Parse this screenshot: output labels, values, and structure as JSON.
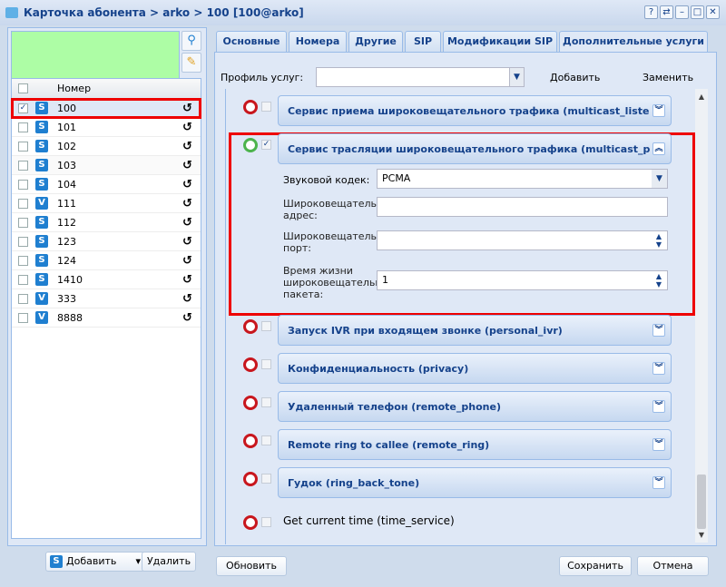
{
  "window": {
    "title": "Карточка абонента > arko > 100 [100@arko]",
    "controls": [
      "?",
      "⇄",
      "–",
      "□",
      "✕"
    ]
  },
  "left": {
    "header": "Номер",
    "rows": [
      {
        "num": "100",
        "type": "S",
        "checked": true
      },
      {
        "num": "101",
        "type": "S"
      },
      {
        "num": "102",
        "type": "S"
      },
      {
        "num": "103",
        "type": "S"
      },
      {
        "num": "104",
        "type": "S"
      },
      {
        "num": "111",
        "type": "V"
      },
      {
        "num": "112",
        "type": "S"
      },
      {
        "num": "123",
        "type": "S"
      },
      {
        "num": "124",
        "type": "S"
      },
      {
        "num": "1410",
        "type": "S"
      },
      {
        "num": "333",
        "type": "V"
      },
      {
        "num": "8888",
        "type": "V"
      }
    ],
    "add_label": "Добавить",
    "delete_label": "Удалить"
  },
  "tabs": [
    "Основные",
    "Номера",
    "Другие",
    "SIP",
    "Модификации SIP",
    "Дополнительные услуги"
  ],
  "profile": {
    "label": "Профиль услуг:",
    "value": "",
    "add": "Добавить",
    "replace": "Заменить"
  },
  "services": [
    {
      "title": "Сервис приема широковещательного трафика (multicast_liste",
      "enabled": false
    },
    {
      "title": "Сервис трасляции широковещательного трафика (multicast_p",
      "enabled": true
    },
    {
      "title": "Запуск IVR при входящем звонке (personal_ivr)",
      "enabled": false
    },
    {
      "title": "Конфиденциальность (privacy)",
      "enabled": false
    },
    {
      "title": "Удаленный телефон (remote_phone)",
      "enabled": false
    },
    {
      "title": "Remote ring to callee (remote_ring)",
      "enabled": false
    },
    {
      "title": "Гудок (ring_back_tone)",
      "enabled": false
    },
    {
      "title": "Get current time (time_service)",
      "enabled": false
    }
  ],
  "form": {
    "codec_label": "Звуковой кодек:",
    "codec_value": "PCMA",
    "addr_label1": "Широковещательный",
    "addr_label2": "адрес:",
    "addr_value": "",
    "port_label1": "Широковещательный",
    "port_label2": "порт:",
    "port_value": "",
    "ttl_label1": "Время жизни",
    "ttl_label2": "широковещательного",
    "ttl_label3": "пакета:",
    "ttl_value": "1"
  },
  "footer": {
    "refresh": "Обновить",
    "save": "Сохранить",
    "cancel": "Отмена"
  }
}
